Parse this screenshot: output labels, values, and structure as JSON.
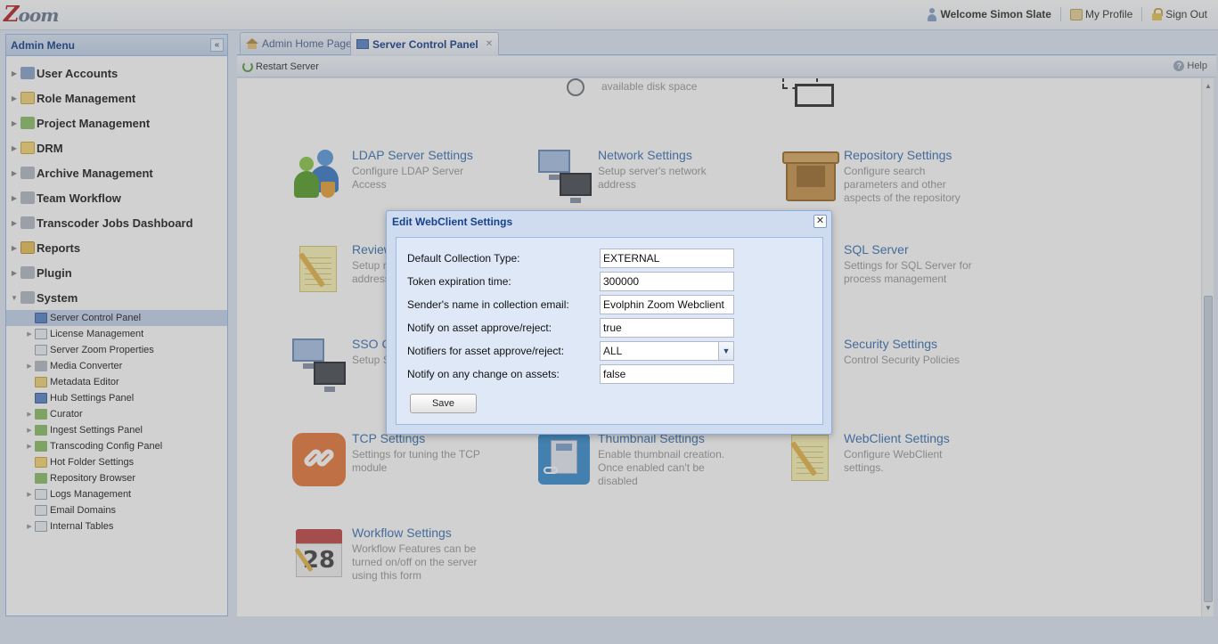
{
  "app": {
    "logo": "Zoom",
    "welcome": "Welcome Simon Slate",
    "my_profile": "My Profile",
    "sign_out": "Sign Out"
  },
  "admin_menu": {
    "title": "Admin Menu",
    "items": [
      {
        "label": "User Accounts"
      },
      {
        "label": "Role Management"
      },
      {
        "label": "Project Management"
      },
      {
        "label": "DRM"
      },
      {
        "label": "Archive Management"
      },
      {
        "label": "Team Workflow"
      },
      {
        "label": "Transcoder Jobs Dashboard"
      },
      {
        "label": "Reports"
      },
      {
        "label": "Plugin"
      },
      {
        "label": "System"
      }
    ],
    "system_children": [
      {
        "label": "Server Control Panel"
      },
      {
        "label": "License Management"
      },
      {
        "label": "Server Zoom Properties"
      },
      {
        "label": "Media Converter"
      },
      {
        "label": "Metadata Editor"
      },
      {
        "label": "Hub Settings Panel"
      },
      {
        "label": "Curator"
      },
      {
        "label": "Ingest Settings Panel"
      },
      {
        "label": "Transcoding Config Panel"
      },
      {
        "label": "Hot Folder Settings"
      },
      {
        "label": "Repository Browser"
      },
      {
        "label": "Logs Management"
      },
      {
        "label": "Email Domains"
      },
      {
        "label": "Internal Tables"
      }
    ]
  },
  "tabs": [
    {
      "label": "Admin Home Page"
    },
    {
      "label": "Server Control Panel"
    }
  ],
  "toolbar": {
    "restart": "Restart Server",
    "help": "Help"
  },
  "grid": {
    "disk_desc": "available disk space",
    "items": [
      {
        "title": "LDAP Server Settings",
        "desc": "Configure LDAP Server Access"
      },
      {
        "title": "Network Settings",
        "desc": "Setup server's network address"
      },
      {
        "title": "Repository Settings",
        "desc": "Configure search parameters and other aspects of the repository"
      },
      {
        "title": "Review",
        "desc": "Setup r address"
      },
      {
        "title": "SQL Server",
        "desc": "Settings for SQL Server for process management"
      },
      {
        "title": "SSO C",
        "desc": "Setup S"
      },
      {
        "title": "Security Settings",
        "desc": "Control Security Policies"
      },
      {
        "title": "TCP Settings",
        "desc": "Settings for tuning the TCP module"
      },
      {
        "title": "Thumbnail Settings",
        "desc": "Enable thumbnail creation. Once enabled can't be disabled"
      },
      {
        "title": "WebClient Settings",
        "desc": "Configure WebClient settings."
      },
      {
        "title": "Workflow Settings",
        "desc": "Workflow Features can be turned on/off on the server using this form"
      }
    ],
    "calendar_day": "28"
  },
  "modal": {
    "title": "Edit WebClient Settings",
    "fields": [
      {
        "label": "Default Collection Type:",
        "value": "EXTERNAL"
      },
      {
        "label": "Token expiration time:",
        "value": "300000"
      },
      {
        "label": "Sender's name in collection email:",
        "value": "Evolphin Zoom Webclient"
      },
      {
        "label": "Notify on asset approve/reject:",
        "value": "true"
      },
      {
        "label": "Notifiers for asset approve/reject:",
        "value": "ALL"
      },
      {
        "label": "Notify on any change on assets:",
        "value": "false"
      }
    ],
    "save": "Save"
  }
}
